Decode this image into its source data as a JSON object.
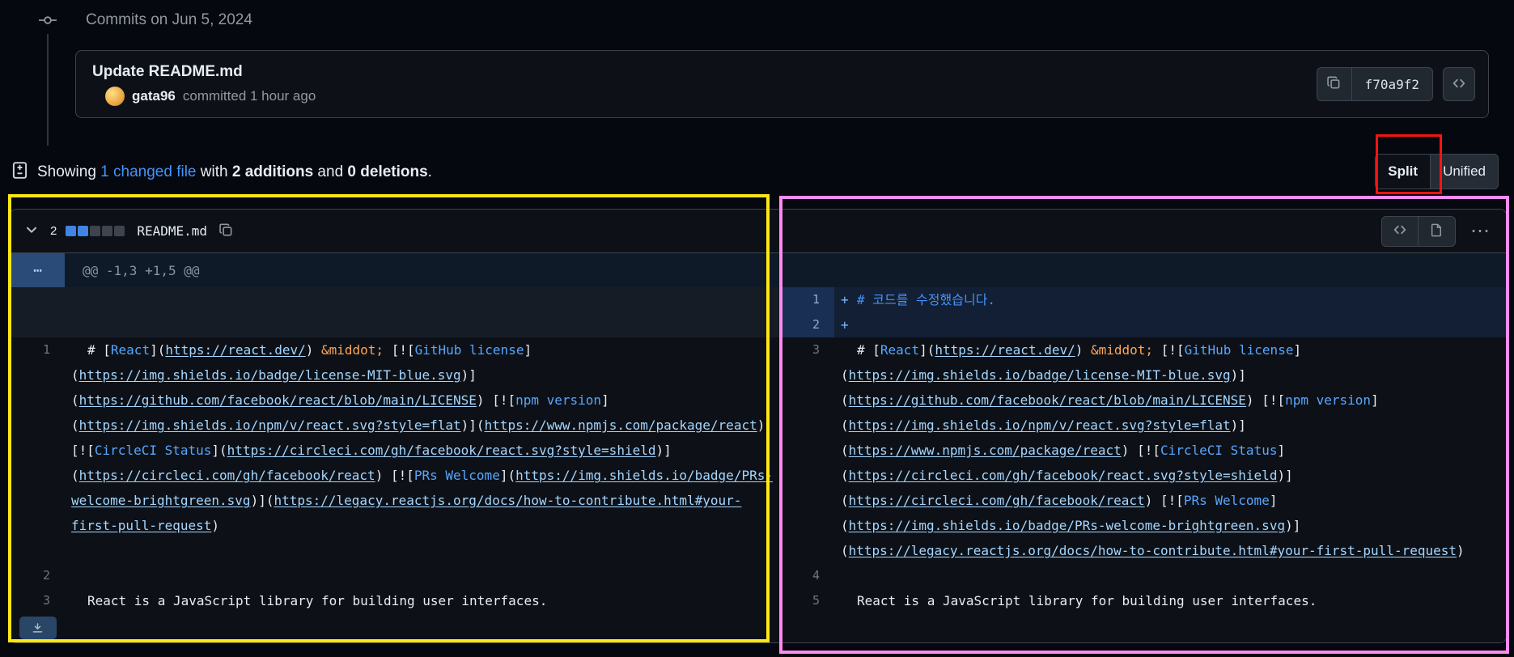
{
  "timeline": {
    "header": "Commits on Jun 5, 2024"
  },
  "commit_card": {
    "title": "Update README.md",
    "author": "gata96",
    "action": "committed 1 hour ago",
    "sha": "f70a9f2"
  },
  "summary": {
    "showing": "Showing ",
    "changed_file_link": "1 changed file",
    "with": " with ",
    "additions": "2 additions",
    "and": " and ",
    "deletions": "0 deletions",
    "period": "."
  },
  "view_toggle": {
    "split": "Split",
    "unified": "Unified"
  },
  "icons": {
    "hunk_expand_dots": "⋯",
    "more_options_dots": "⋯"
  },
  "colors": {
    "link_blue": "#58a6ff",
    "url_blue": "#a5d6ff",
    "entity_orange": "#ffa657",
    "heading_blue": "#4493f8",
    "addition_square_blue": "#4184e4",
    "neutral_square_gray": "#3d444d"
  },
  "annotations": {
    "split_button_box": "#f81313",
    "left_pane_box": "#ffe711",
    "right_pane_box": "#ff8af0"
  },
  "file_diff": {
    "changed_count": "2",
    "diff_stat_squares": [
      "#4184e4",
      "#4184e4",
      "#3d444d",
      "#3d444d",
      "#3d444d"
    ],
    "filename": "README.md",
    "hunk_header": "@@ -1,3 +1,5 @@",
    "line_segments": {
      "korean_heading": [
        {
          "s": "heading",
          "t": "# 코드를 수정했습니다."
        }
      ],
      "react_markdown": [
        {
          "s": "plain",
          "t": "# ["
        },
        {
          "s": "link",
          "t": "React"
        },
        {
          "s": "plain",
          "t": "]("
        },
        {
          "s": "url",
          "t": "https://react.dev/"
        },
        {
          "s": "plain",
          "t": ") "
        },
        {
          "s": "entity",
          "t": "&middot;"
        },
        {
          "s": "plain",
          "t": " [!["
        },
        {
          "s": "link",
          "t": "GitHub license"
        },
        {
          "s": "plain",
          "t": "]("
        },
        {
          "s": "url",
          "t": "https://img.shields.io/badge/license-MIT-blue.svg"
        },
        {
          "s": "plain",
          "t": ")]("
        },
        {
          "s": "url",
          "t": "https://github.com/facebook/react/blob/main/LICENSE"
        },
        {
          "s": "plain",
          "t": ") [!["
        },
        {
          "s": "link",
          "t": "npm version"
        },
        {
          "s": "plain",
          "t": "]("
        },
        {
          "s": "url",
          "t": "https://img.shields.io/npm/v/react.svg?style=flat"
        },
        {
          "s": "plain",
          "t": ")]("
        },
        {
          "s": "url",
          "t": "https://www.npmjs.com/package/react"
        },
        {
          "s": "plain",
          "t": ") [!["
        },
        {
          "s": "link",
          "t": "CircleCI Status"
        },
        {
          "s": "plain",
          "t": "]("
        },
        {
          "s": "url",
          "t": "https://circleci.com/gh/facebook/react.svg?style=shield"
        },
        {
          "s": "plain",
          "t": ")]("
        },
        {
          "s": "url",
          "t": "https://circleci.com/gh/facebook/react"
        },
        {
          "s": "plain",
          "t": ") [!["
        },
        {
          "s": "link",
          "t": "PRs Welcome"
        },
        {
          "s": "plain",
          "t": "]("
        },
        {
          "s": "url",
          "t": "https://img.shields.io/badge/PRs-welcome-brightgreen.svg"
        },
        {
          "s": "plain",
          "t": ")]("
        },
        {
          "s": "url",
          "t": "https://legacy.reactjs.org/docs/how-to-contribute.html#your-first-pull-request"
        },
        {
          "s": "plain",
          "t": ")"
        }
      ],
      "react_text": [
        {
          "s": "plain",
          "t": "React is a JavaScript library for building user interfaces."
        }
      ]
    },
    "rows": [
      {
        "kind": "hunk"
      },
      {
        "kind": "line",
        "left": {
          "type": "empty"
        },
        "right": {
          "type": "add",
          "num": "1",
          "seg": "korean_heading"
        }
      },
      {
        "kind": "line",
        "left": {
          "type": "empty"
        },
        "right": {
          "type": "add",
          "num": "2"
        }
      },
      {
        "kind": "line",
        "left": {
          "type": "ctx",
          "num": "1",
          "seg": "react_markdown"
        },
        "right": {
          "type": "ctx",
          "num": "3",
          "seg": "react_markdown"
        }
      },
      {
        "kind": "line",
        "left": {
          "type": "ctx",
          "num": "2"
        },
        "right": {
          "type": "ctx",
          "num": "4"
        }
      },
      {
        "kind": "line",
        "left": {
          "type": "ctx",
          "num": "3",
          "seg": "react_text"
        },
        "right": {
          "type": "ctx",
          "num": "5",
          "seg": "react_text"
        }
      },
      {
        "kind": "expand"
      }
    ]
  }
}
